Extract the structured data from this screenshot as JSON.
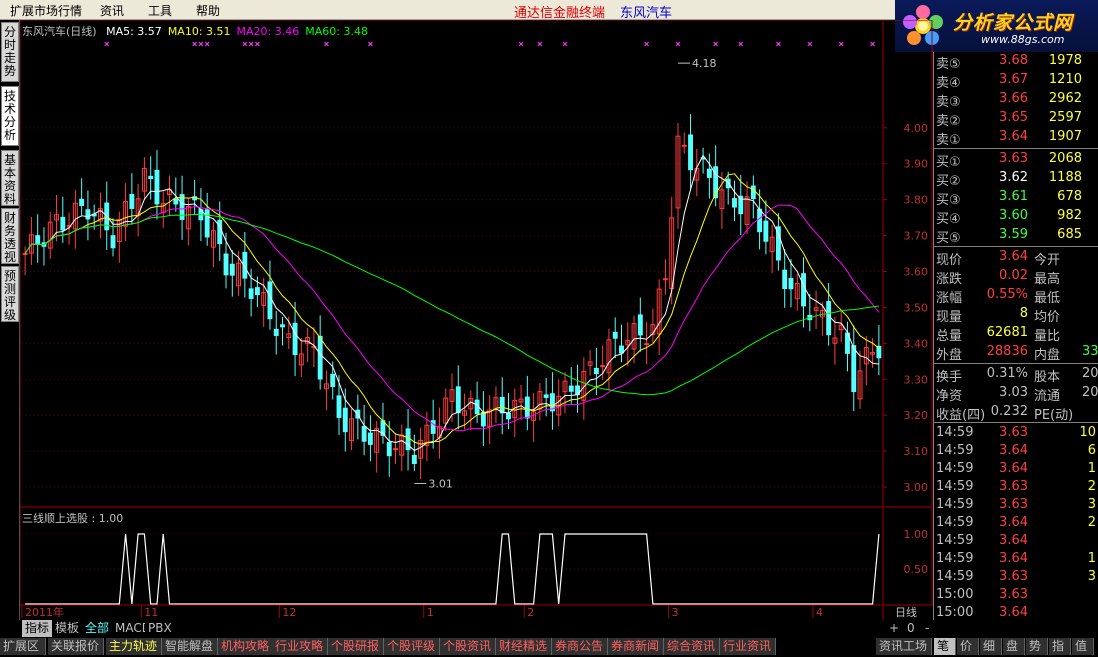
{
  "menubar": {
    "items": [
      "扩展市场行情",
      "资讯",
      "工具",
      "帮助"
    ],
    "app_title": "通达信金融终端",
    "stock_title": "东风汽车"
  },
  "logo": {
    "main": "分析家公式网",
    "sub": "www.88gs.com"
  },
  "left_tabs": [
    "分时走势",
    "技术分析",
    "基本资料",
    "财务透视",
    "预测评级"
  ],
  "main_legend": {
    "name": "东风汽车(日线)",
    "items": [
      {
        "label": "MA5: 3.57",
        "color": "#ffffff"
      },
      {
        "label": "MA10: 3.51",
        "color": "#ffff00"
      },
      {
        "label": "MA20: 3.46",
        "color": "#ff00ff"
      },
      {
        "label": "MA60: 3.48",
        "color": "#00ff00"
      }
    ]
  },
  "sub_legend": "三线顺上选股 : 1.00",
  "annotations": {
    "high": "4.18",
    "low": "3.01"
  },
  "chart_data": {
    "type": "candlestick",
    "ylim": [
      2.95,
      4.25
    ],
    "y_ticks": [
      "4.00",
      "3.90",
      "3.80",
      "3.70",
      "3.60",
      "3.50",
      "3.40",
      "3.30",
      "3.20",
      "3.10",
      "3.00"
    ],
    "sub_ylim": [
      0,
      1.2
    ],
    "sub_ticks": [
      "1.00",
      "0.50"
    ],
    "x_labels": [
      {
        "label": "2011年",
        "index": 0
      },
      {
        "label": "11",
        "index": 19
      },
      {
        "label": "12",
        "index": 41
      },
      {
        "label": "1",
        "index": 64
      },
      {
        "label": "2",
        "index": 80
      },
      {
        "label": "3",
        "index": 103
      },
      {
        "label": "4",
        "index": 126
      }
    ],
    "period_label": "日线",
    "signal": [
      0,
      0,
      0,
      0,
      0,
      0,
      0,
      0,
      0,
      0,
      0,
      0,
      0,
      0,
      0,
      0,
      1,
      0,
      1,
      1,
      0,
      0,
      1,
      0,
      0,
      0,
      0,
      0,
      0,
      0,
      0,
      0,
      0,
      0,
      0,
      0,
      0,
      0,
      0,
      0,
      0,
      0,
      0,
      0,
      0,
      0,
      0,
      0,
      0,
      0,
      0,
      0,
      0,
      0,
      0,
      0,
      0,
      0,
      0,
      0,
      0,
      0,
      0,
      0,
      0,
      0,
      0,
      0,
      0,
      0,
      0,
      0,
      0,
      0,
      0,
      0,
      1,
      1,
      0,
      0,
      0,
      0,
      1,
      1,
      1,
      0,
      1,
      1,
      1,
      1,
      1,
      1,
      1,
      1,
      1,
      1,
      1,
      1,
      1,
      1,
      0,
      0,
      0,
      0,
      0,
      0,
      0,
      0,
      0,
      0,
      0,
      0,
      0,
      0,
      0,
      0,
      0,
      0,
      0,
      0,
      0,
      0,
      0,
      0,
      0,
      0,
      0,
      0,
      0,
      0,
      0,
      0,
      0,
      0,
      0,
      0,
      1
    ]
  },
  "quote": {
    "sell": [
      {
        "label": "卖⑤",
        "price": "3.68",
        "vol": "1978"
      },
      {
        "label": "卖④",
        "price": "3.67",
        "vol": "1210"
      },
      {
        "label": "卖③",
        "price": "3.66",
        "vol": "2962"
      },
      {
        "label": "卖②",
        "price": "3.65",
        "vol": "2597"
      },
      {
        "label": "卖①",
        "price": "3.64",
        "vol": "1907"
      }
    ],
    "buy": [
      {
        "label": "买①",
        "price": "3.63",
        "vol": "2068",
        "color": "#ff4040"
      },
      {
        "label": "买②",
        "price": "3.62",
        "vol": "1188",
        "color": "#ffffff"
      },
      {
        "label": "买③",
        "price": "3.61",
        "vol": "678",
        "color": "#40ff40"
      },
      {
        "label": "买④",
        "price": "3.60",
        "vol": "982",
        "color": "#40ff40"
      },
      {
        "label": "买⑤",
        "price": "3.59",
        "vol": "685",
        "color": "#40ff40"
      }
    ],
    "stats": [
      {
        "l1": "现价",
        "v1": "3.64",
        "c1": "#ff4040",
        "l2": "今开",
        "v2": ""
      },
      {
        "l1": "涨跌",
        "v1": "0.02",
        "c1": "#ff4040",
        "l2": "最高",
        "v2": ""
      },
      {
        "l1": "涨幅",
        "v1": "0.55%",
        "c1": "#ff4040",
        "l2": "最低",
        "v2": ""
      },
      {
        "l1": "现量",
        "v1": "8",
        "c1": "#ffff40",
        "l2": "均价",
        "v2": ""
      },
      {
        "l1": "总量",
        "v1": "62681",
        "c1": "#ffff40",
        "l2": "量比",
        "v2": ""
      },
      {
        "l1": "外盘",
        "v1": "28836",
        "c1": "#ff4040",
        "l2": "内盘",
        "v2": "33"
      }
    ],
    "fin": [
      {
        "l1": "换手",
        "v1": "0.31%",
        "l2": "股本",
        "v2": "20"
      },
      {
        "l1": "净资",
        "v1": "3.03",
        "l2": "流通",
        "v2": "20"
      },
      {
        "l1": "收益(四)",
        "v1": "0.232",
        "l2": "PE(动)",
        "v2": ""
      }
    ],
    "ticks": [
      {
        "t": "14:59",
        "p": "3.63",
        "v": "10"
      },
      {
        "t": "14:59",
        "p": "3.64",
        "v": "6"
      },
      {
        "t": "14:59",
        "p": "3.64",
        "v": "1"
      },
      {
        "t": "14:59",
        "p": "3.63",
        "v": "2"
      },
      {
        "t": "14:59",
        "p": "3.63",
        "v": "3"
      },
      {
        "t": "14:59",
        "p": "3.64",
        "v": "2"
      },
      {
        "t": "14:59",
        "p": "3.64",
        "v": ""
      },
      {
        "t": "14:59",
        "p": "3.64",
        "v": "1"
      },
      {
        "t": "14:59",
        "p": "3.63",
        "v": "3"
      },
      {
        "t": "15:00",
        "p": "3.63",
        "v": ""
      },
      {
        "t": "15:00",
        "p": "3.64",
        "v": ""
      }
    ]
  },
  "indicator_tabs": [
    "指标",
    "模板",
    "全部",
    "MACD",
    "PBX"
  ],
  "zoom_controls": [
    "+",
    "0",
    "-"
  ],
  "bottom_tabs": [
    "扩展区",
    "关联报价",
    "主力轨迹",
    "智能解盘",
    "机构攻略",
    "行业攻略",
    "个股研报",
    "个股评级",
    "个股资讯",
    "财经精选",
    "券商公告",
    "券商新闻",
    "综合资讯",
    "行业资讯",
    "资讯工场"
  ],
  "right_bottom_tabs": [
    "笔",
    "价",
    "细",
    "盘",
    "势",
    "指",
    "值"
  ]
}
